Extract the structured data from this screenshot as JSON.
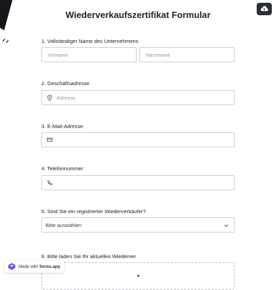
{
  "title": "Wiederverkaufszertifikat Formular",
  "colors": {
    "accent": "#2b2f36",
    "border": "#cfcfd4",
    "placeholder": "#9a9aa2",
    "badge_logo": "#6c4cf5"
  },
  "top_button": {
    "icon": "cloud-upload-icon"
  },
  "questions": {
    "q1": {
      "label": "1.  Vollständiger Name des Unternehmens",
      "first_placeholder": "Vorname",
      "last_placeholder": "Nachname"
    },
    "q2": {
      "label": "2. Geschäftsadresse",
      "placeholder": "Adresse",
      "icon": "location-pin-icon"
    },
    "q3": {
      "label": "3. E-Mail-Adresse",
      "icon": "mail-icon"
    },
    "q4": {
      "label": "4. Telefonnummer",
      "icon": "phone-icon"
    },
    "q5": {
      "label": "5. Sind Sie ein registrierter Wiederverkäufer?",
      "selected": "Bitte auswählen",
      "icon": "chevron-down-icon"
    },
    "q6": {
      "label": "6. Bitte laden Sie Ihr aktuelles Wiederver"
    }
  },
  "badge": {
    "made_with": "Made with",
    "brand": "forms.app"
  }
}
